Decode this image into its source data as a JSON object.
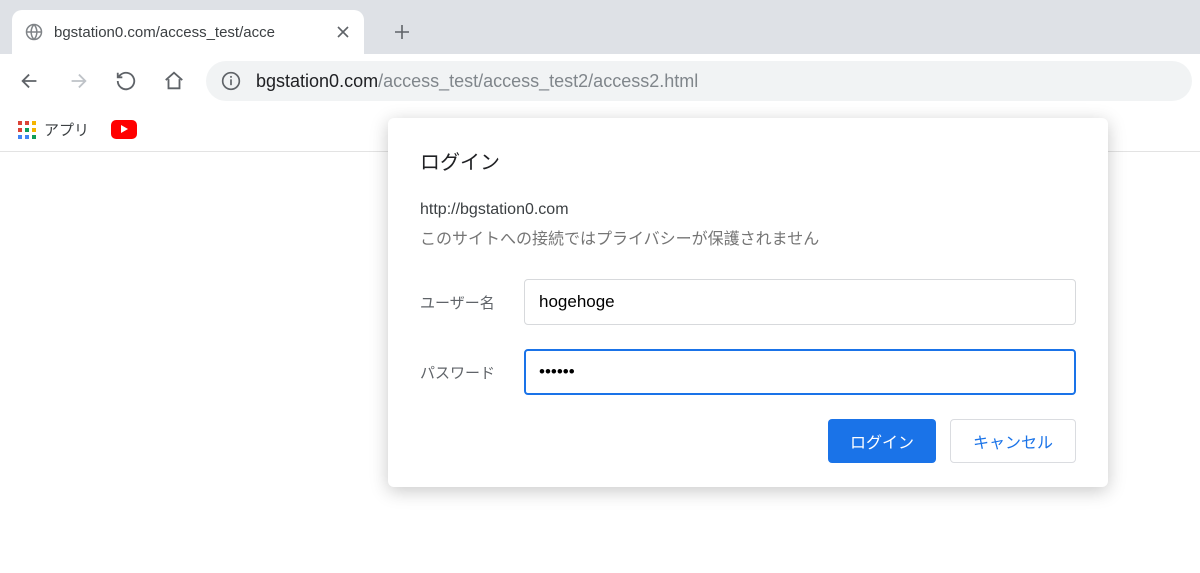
{
  "tab": {
    "title": "bgstation0.com/access_test/acce"
  },
  "omnibox": {
    "host": "bgstation0.com",
    "path": "/access_test/access_test2/access2.html"
  },
  "bookmarks": {
    "apps_label": "アプリ"
  },
  "dialog": {
    "title": "ログイン",
    "origin": "http://bgstation0.com",
    "warning": "このサイトへの接続ではプライバシーが保護されません",
    "username_label": "ユーザー名",
    "username_value": "hogehoge",
    "password_label": "パスワード",
    "password_value": "••••••",
    "login_button": "ログイン",
    "cancel_button": "キャンセル"
  }
}
